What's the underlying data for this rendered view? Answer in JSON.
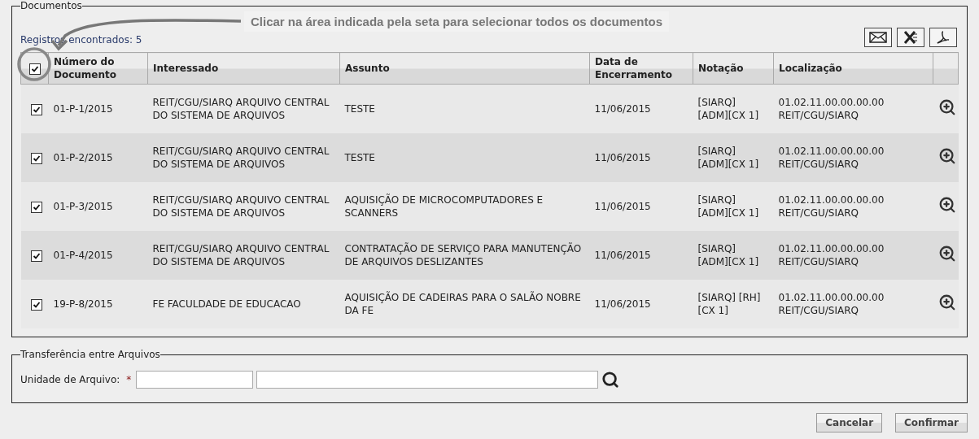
{
  "documents": {
    "legend": "Documentos",
    "count": "Registros encontrados: 5",
    "hint": "Clicar na área indicada pela seta para selecionar todos os documentos",
    "select_all": {
      "checked": true
    },
    "columns": [
      "Número do Documento",
      "Interessado",
      "Assunto",
      "Data de Encerramento",
      "Notação",
      "Localização"
    ],
    "rows": [
      {
        "checked": true,
        "cells": [
          "01-P-1/2015",
          "REIT/CGU/SIARQ ARQUIVO CENTRAL DO SISTEMA DE ARQUIVOS",
          "TESTE",
          "11/06/2015",
          "[SIARQ] [ADM][CX 1]",
          "01.02.11.00.00.00.00 REIT/CGU/SIARQ"
        ]
      },
      {
        "checked": true,
        "cells": [
          "01-P-2/2015",
          "REIT/CGU/SIARQ ARQUIVO CENTRAL DO SISTEMA DE ARQUIVOS",
          "TESTE",
          "11/06/2015",
          "[SIARQ] [ADM][CX 1]",
          "01.02.11.00.00.00.00 REIT/CGU/SIARQ"
        ]
      },
      {
        "checked": true,
        "cells": [
          "01-P-3/2015",
          "REIT/CGU/SIARQ ARQUIVO CENTRAL DO SISTEMA DE ARQUIVOS",
          "AQUISIÇÃO DE MICROCOMPUTADORES E SCANNERS",
          "11/06/2015",
          "[SIARQ] [ADM][CX 1]",
          "01.02.11.00.00.00.00 REIT/CGU/SIARQ"
        ]
      },
      {
        "checked": true,
        "cells": [
          "01-P-4/2015",
          "REIT/CGU/SIARQ ARQUIVO CENTRAL DO SISTEMA DE ARQUIVOS",
          "CONTRATAÇÃO DE SERVIÇO PARA MANUTENÇÃO DE ARQUIVOS DESLIZANTES",
          "11/06/2015",
          "[SIARQ] [ADM][CX 1]",
          "01.02.11.00.00.00.00 REIT/CGU/SIARQ"
        ]
      },
      {
        "checked": true,
        "cells": [
          "19-P-8/2015",
          "FE FACULDADE DE EDUCACAO",
          "AQUISIÇÃO DE CADEIRAS PARA O SALÃO NOBRE DA FE",
          "11/06/2015",
          "[SIARQ] [RH][CX 1]",
          "01.02.11.00.00.00.00 REIT/CGU/SIARQ"
        ]
      }
    ]
  },
  "transfer": {
    "legend": "Transferência entre Arquivos",
    "label": "Unidade de Arquivo:",
    "required": "*"
  },
  "buttons": [
    "Cancelar",
    "Confirmar"
  ]
}
